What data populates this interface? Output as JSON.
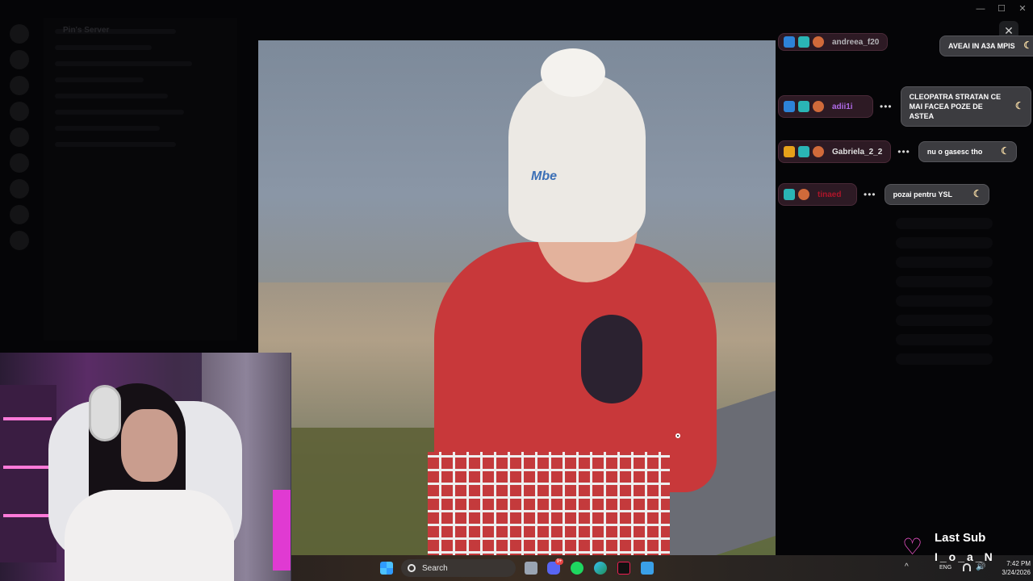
{
  "background": {
    "server_name": "Pin's Server"
  },
  "window_controls": {
    "minimize": "—",
    "maximize": "☐",
    "close": "✕"
  },
  "viewer": {
    "close_label": "✕",
    "hat_logo": "Mbe"
  },
  "chat": {
    "messages": [
      {
        "user": "andreea_f20",
        "badges": [
          "mod-icon",
          "vip-icon",
          "emote-icon"
        ],
        "text": "AVEAI IN A3A MPIS",
        "name_color": "#b4b4b8"
      },
      {
        "user": "adii1i",
        "badges": [
          "mod-icon",
          "vip-icon",
          "emote-icon"
        ],
        "text": "CLEOPATRA STRATAN CE MAI FACEA POZE DE ASTEA",
        "name_color": "#b06be8"
      },
      {
        "user": "Gabriela_2_2",
        "badges": [
          "sub-icon",
          "vip-icon",
          "emote-icon"
        ],
        "text": "nu o gasesc tho",
        "name_color": "#e0e0e0"
      },
      {
        "user": "tinaed",
        "badges": [
          "vip-icon",
          "emote-icon"
        ],
        "text": "pozai pentru YSL",
        "name_color": "#b0152a"
      }
    ],
    "dots": "•••",
    "moon": "☾"
  },
  "taskbar": {
    "search_label": "Search",
    "discord_badge": "9+",
    "chevron": "^",
    "language": "ENG",
    "speaker": "🔊",
    "time": "7:42 PM",
    "date": "3/24/2026"
  },
  "overlay": {
    "heart": "♡",
    "last_sub_title": "Last Sub",
    "last_sub_name": "I_o_a_N"
  },
  "colors": {
    "accent_pink": "#ff58d8",
    "chat_pill": "#2d1a24",
    "bubble": "#3c3c40"
  }
}
